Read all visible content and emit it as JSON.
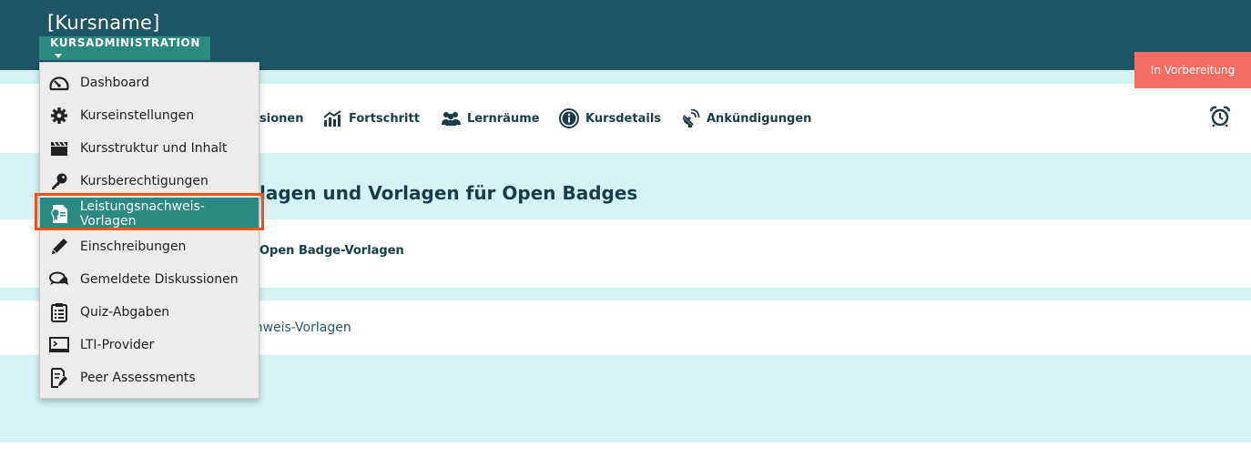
{
  "header": {
    "course_name": "[Kursname]",
    "admin_button_label": "KURSADMINISTRATION",
    "status_badge": "In Vorbereitung"
  },
  "nav": {
    "items": [
      {
        "label": "sionen",
        "icon": "sessions-icon"
      },
      {
        "label": "Fortschritt",
        "icon": "progress-chart-icon"
      },
      {
        "label": "Lernräume",
        "icon": "group-icon"
      },
      {
        "label": "Kursdetails",
        "icon": "info-icon"
      },
      {
        "label": "Ankündigungen",
        "icon": "satellite-icon"
      }
    ],
    "right_icon": "alarm-clock-icon"
  },
  "main": {
    "title": "lagen und Vorlagen für Open Badges",
    "section_link": "Open Badge-Vorlagen",
    "row_link": "chweis-Vorlagen"
  },
  "dropdown": {
    "items": [
      {
        "label": "Dashboard",
        "icon": "gauge-icon"
      },
      {
        "label": "Kurseinstellungen",
        "icon": "gear-icon"
      },
      {
        "label": "Kursstruktur und Inhalt",
        "icon": "clapperboard-icon"
      },
      {
        "label": "Kursberechtigungen",
        "icon": "key-icon"
      },
      {
        "label": "Leistungsnachweis-Vorlagen",
        "icon": "certificate-icon",
        "active": true
      },
      {
        "label": "Einschreibungen",
        "icon": "pencil-icon"
      },
      {
        "label": "Gemeldete Diskussionen",
        "icon": "chat-bubbles-icon"
      },
      {
        "label": "Quiz-Abgaben",
        "icon": "clipboard-icon"
      },
      {
        "label": "LTI-Provider",
        "icon": "terminal-icon"
      },
      {
        "label": "Peer Assessments",
        "icon": "document-edit-icon"
      }
    ]
  },
  "colors": {
    "header_bg": "#1e5565",
    "accent": "#2a8a80",
    "badge": "#f66d64",
    "light_teal": "#d4f3f2",
    "highlight_outline": "#ef4f21"
  }
}
